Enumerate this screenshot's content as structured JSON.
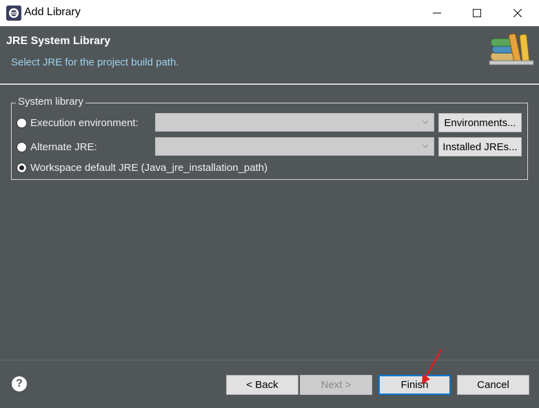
{
  "window": {
    "title": "Add Library"
  },
  "banner": {
    "title": "JRE System Library",
    "description": "Select JRE for the project build path."
  },
  "group": {
    "legend": "System library",
    "options": [
      {
        "label": "Execution environment:",
        "selected": false
      },
      {
        "label": "Alternate JRE:",
        "selected": false
      },
      {
        "label": "Workspace default JRE (Java_jre_installation_path)",
        "selected": true
      }
    ],
    "environments_button": "Environments...",
    "installed_jres_button": "Installed JREs..."
  },
  "buttons": {
    "back": "< Back",
    "next": "Next >",
    "finish": "Finish",
    "cancel": "Cancel"
  },
  "icons": {
    "help": "?"
  },
  "colors": {
    "background": "#515658",
    "description_text": "#9ed3ee",
    "focus_border": "#0078d7",
    "annotation_arrow": "#e02020"
  }
}
